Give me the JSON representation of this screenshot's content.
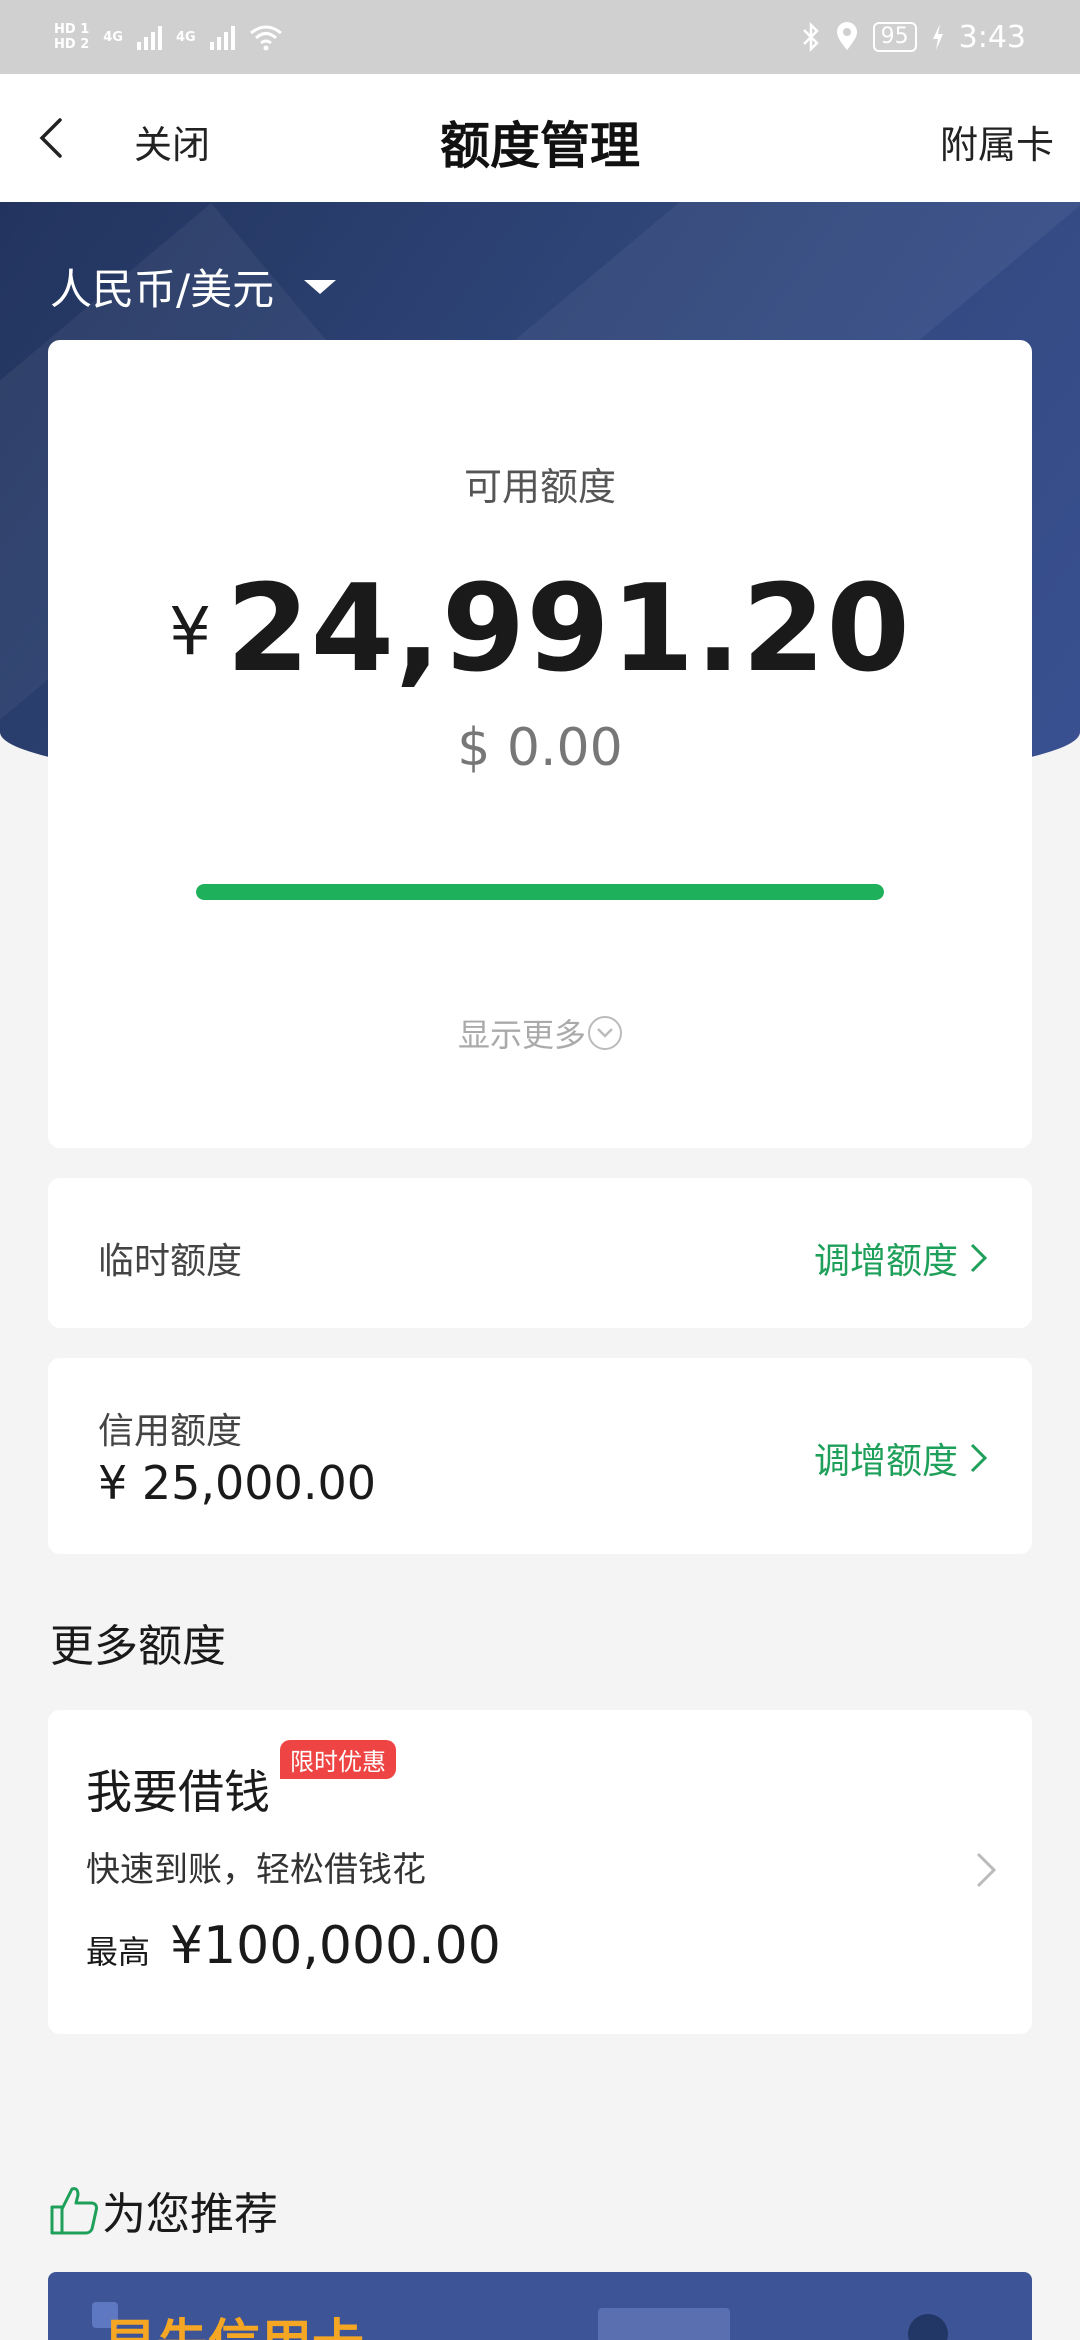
{
  "status_bar": {
    "sim1": "HD 1",
    "sim2": "HD 2",
    "net1": "4G",
    "net2": "4G",
    "battery": "95",
    "time": "3:43"
  },
  "header": {
    "close_label": "关闭",
    "title": "额度管理",
    "supplementary_card_label": "附属卡"
  },
  "currency_selector": {
    "value": "人民币/美元"
  },
  "available": {
    "label": "可用额度",
    "rmb_symbol": "¥",
    "rmb_amount": "24,991.20",
    "usd_amount": "$ 0.00",
    "progress_fraction": 1.0,
    "show_more": "显示更多"
  },
  "temporary_limit": {
    "label": "临时额度",
    "action": "调增额度"
  },
  "credit_limit": {
    "label": "信用额度",
    "value": "¥ 25,000.00",
    "action": "调增额度"
  },
  "more_limits": {
    "title": "更多额度",
    "loan": {
      "title": "我要借钱",
      "badge": "限时优惠",
      "description": "快速到账，轻松借钱花",
      "max_label": "最高",
      "max_value": "¥100,000.00"
    }
  },
  "recommend": {
    "title": "为您推荐",
    "banner_text": "早先信用卡"
  },
  "colors": {
    "accent_green": "#1fb05c",
    "hero_blue": "#2f4578",
    "badge_red": "#ee4544"
  }
}
